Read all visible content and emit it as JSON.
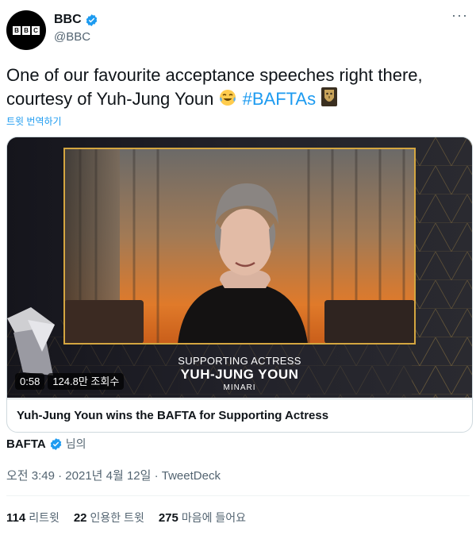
{
  "header": {
    "avatar_logo": [
      "B",
      "B",
      "C"
    ],
    "display_name": "BBC",
    "handle": "@BBC",
    "more_label": "···"
  },
  "tweet": {
    "text_part1": "One of our favourite acceptance speeches right there, courtesy of Yuh-Jung Youn",
    "hashtag": "#BAFTAs",
    "translate_label": "트윗 번역하기"
  },
  "media": {
    "duration": "0:58",
    "views": "124.8만 조회수",
    "lower_third": {
      "line1": "SUPPORTING ACTRESS",
      "line2": "YUH-JUNG YOUN",
      "line3": "MINARI"
    },
    "caption": "Yuh-Jung Youn wins the BAFTA for Supporting Actress"
  },
  "source": {
    "name": "BAFTA",
    "suffix": "님의"
  },
  "meta": {
    "timestamp": "오전 3:49 · 2021년 4월 12일 · TweetDeck"
  },
  "stats": [
    {
      "count": "114",
      "label": "리트윗"
    },
    {
      "count": "22",
      "label": "인용한 트윗"
    },
    {
      "count": "275",
      "label": "마음에 들어요"
    }
  ],
  "colors": {
    "accent": "#1d9bf0",
    "verified": "#1d9bf0",
    "text": "#0f1419",
    "secondary": "#536471"
  }
}
